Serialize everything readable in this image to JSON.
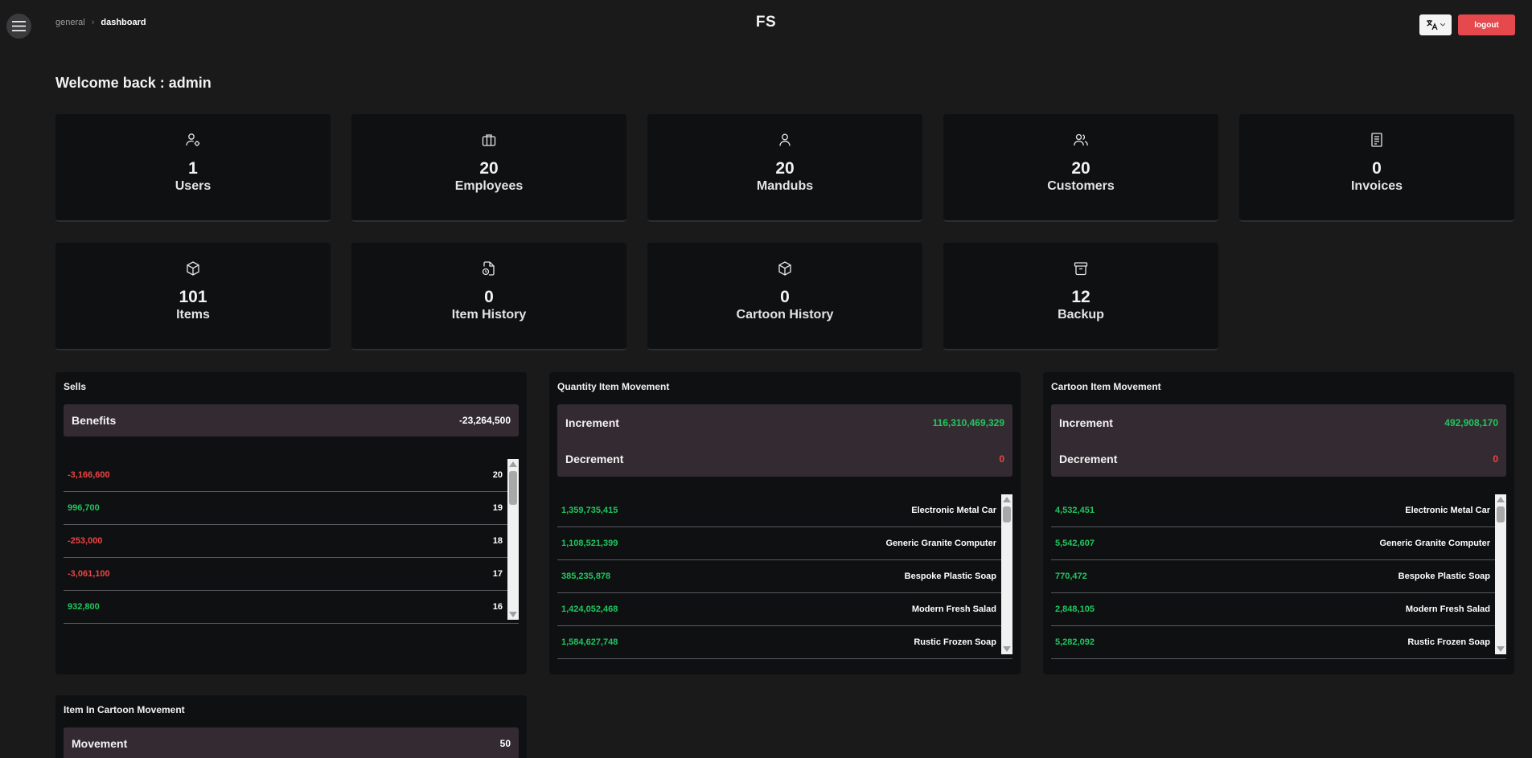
{
  "header": {
    "breadcrumb": [
      "general",
      "dashboard"
    ],
    "brand": "FS",
    "logout_label": "logout",
    "icons": {
      "menu": "hamburger-icon",
      "language": "translate-icon"
    }
  },
  "welcome": "Welcome back : admin",
  "stats": [
    {
      "value": "1",
      "label": "Users",
      "icon": "user-gear-icon"
    },
    {
      "value": "20",
      "label": "Employees",
      "icon": "briefcase-icon"
    },
    {
      "value": "20",
      "label": "Mandubs",
      "icon": "user-icon"
    },
    {
      "value": "20",
      "label": "Customers",
      "icon": "users-icon"
    },
    {
      "value": "0",
      "label": "Invoices",
      "icon": "invoice-icon"
    },
    {
      "value": "101",
      "label": "Items",
      "icon": "box-icon"
    },
    {
      "value": "0",
      "label": "Item History",
      "icon": "file-history-icon"
    },
    {
      "value": "0",
      "label": "Cartoon History",
      "icon": "box-icon"
    },
    {
      "value": "12",
      "label": "Backup",
      "icon": "archive-icon"
    }
  ],
  "sells": {
    "title": "Sells",
    "summary": [
      {
        "key": "Benefits",
        "value": "-23,264,500"
      }
    ],
    "rows": [
      {
        "left": "-3,166,600",
        "right": "20",
        "sign": "negative"
      },
      {
        "left": "996,700",
        "right": "19",
        "sign": "positive"
      },
      {
        "left": "-253,000",
        "right": "18",
        "sign": "negative"
      },
      {
        "left": "-3,061,100",
        "right": "17",
        "sign": "negative"
      },
      {
        "left": "932,800",
        "right": "16",
        "sign": "positive"
      }
    ]
  },
  "quantity_movement": {
    "title": "Quantity Item Movement",
    "summary": [
      {
        "key": "Increment",
        "value": "116,310,469,329",
        "sign": "positive"
      },
      {
        "key": "Decrement",
        "value": "0",
        "sign": "negative"
      }
    ],
    "rows": [
      {
        "left": "1,359,735,415",
        "right": "Electronic Metal Car"
      },
      {
        "left": "1,108,521,399",
        "right": "Generic Granite Computer"
      },
      {
        "left": "385,235,878",
        "right": "Bespoke Plastic Soap"
      },
      {
        "left": "1,424,052,468",
        "right": "Modern Fresh Salad"
      },
      {
        "left": "1,584,627,748",
        "right": "Rustic Frozen Soap"
      }
    ]
  },
  "cartoon_movement": {
    "title": "Cartoon Item Movement",
    "summary": [
      {
        "key": "Increment",
        "value": "492,908,170",
        "sign": "positive"
      },
      {
        "key": "Decrement",
        "value": "0",
        "sign": "negative"
      }
    ],
    "rows": [
      {
        "left": "4,532,451",
        "right": "Electronic Metal Car"
      },
      {
        "left": "5,542,607",
        "right": "Generic Granite Computer"
      },
      {
        "left": "770,472",
        "right": "Bespoke Plastic Soap"
      },
      {
        "left": "2,848,105",
        "right": "Modern Fresh Salad"
      },
      {
        "left": "5,282,092",
        "right": "Rustic Frozen Soap"
      }
    ]
  },
  "item_in_cartoon": {
    "title": "Item In Cartoon Movement",
    "summary": [
      {
        "key": "Movement",
        "value": "50"
      }
    ]
  },
  "colors": {
    "positive": "#22c55e",
    "negative": "#ef4444",
    "accent": "#e5484d",
    "summary_bg": "#342b32",
    "card_bg": "#0e1012"
  }
}
